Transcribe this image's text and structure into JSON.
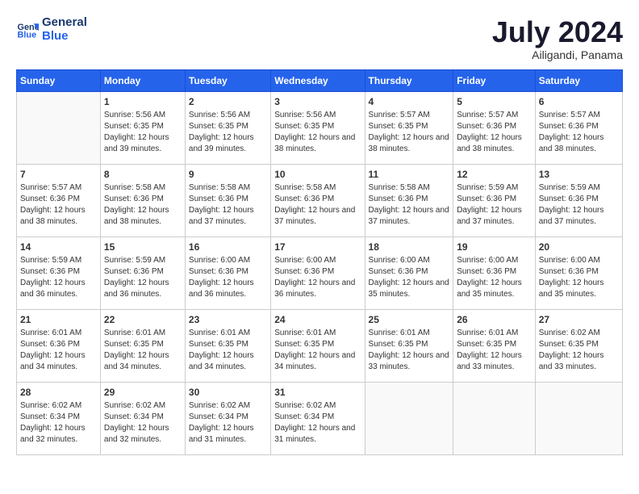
{
  "header": {
    "logo_line1": "General",
    "logo_line2": "Blue",
    "month_title": "July 2024",
    "location": "Ailigandi, Panama"
  },
  "weekdays": [
    "Sunday",
    "Monday",
    "Tuesday",
    "Wednesday",
    "Thursday",
    "Friday",
    "Saturday"
  ],
  "weeks": [
    [
      {
        "day": "",
        "sunrise": "",
        "sunset": "",
        "daylight": ""
      },
      {
        "day": "1",
        "sunrise": "5:56 AM",
        "sunset": "6:35 PM",
        "daylight": "12 hours and 39 minutes."
      },
      {
        "day": "2",
        "sunrise": "5:56 AM",
        "sunset": "6:35 PM",
        "daylight": "12 hours and 39 minutes."
      },
      {
        "day": "3",
        "sunrise": "5:56 AM",
        "sunset": "6:35 PM",
        "daylight": "12 hours and 38 minutes."
      },
      {
        "day": "4",
        "sunrise": "5:57 AM",
        "sunset": "6:35 PM",
        "daylight": "12 hours and 38 minutes."
      },
      {
        "day": "5",
        "sunrise": "5:57 AM",
        "sunset": "6:36 PM",
        "daylight": "12 hours and 38 minutes."
      },
      {
        "day": "6",
        "sunrise": "5:57 AM",
        "sunset": "6:36 PM",
        "daylight": "12 hours and 38 minutes."
      }
    ],
    [
      {
        "day": "7",
        "sunrise": "5:57 AM",
        "sunset": "6:36 PM",
        "daylight": "12 hours and 38 minutes."
      },
      {
        "day": "8",
        "sunrise": "5:58 AM",
        "sunset": "6:36 PM",
        "daylight": "12 hours and 38 minutes."
      },
      {
        "day": "9",
        "sunrise": "5:58 AM",
        "sunset": "6:36 PM",
        "daylight": "12 hours and 37 minutes."
      },
      {
        "day": "10",
        "sunrise": "5:58 AM",
        "sunset": "6:36 PM",
        "daylight": "12 hours and 37 minutes."
      },
      {
        "day": "11",
        "sunrise": "5:58 AM",
        "sunset": "6:36 PM",
        "daylight": "12 hours and 37 minutes."
      },
      {
        "day": "12",
        "sunrise": "5:59 AM",
        "sunset": "6:36 PM",
        "daylight": "12 hours and 37 minutes."
      },
      {
        "day": "13",
        "sunrise": "5:59 AM",
        "sunset": "6:36 PM",
        "daylight": "12 hours and 37 minutes."
      }
    ],
    [
      {
        "day": "14",
        "sunrise": "5:59 AM",
        "sunset": "6:36 PM",
        "daylight": "12 hours and 36 minutes."
      },
      {
        "day": "15",
        "sunrise": "5:59 AM",
        "sunset": "6:36 PM",
        "daylight": "12 hours and 36 minutes."
      },
      {
        "day": "16",
        "sunrise": "6:00 AM",
        "sunset": "6:36 PM",
        "daylight": "12 hours and 36 minutes."
      },
      {
        "day": "17",
        "sunrise": "6:00 AM",
        "sunset": "6:36 PM",
        "daylight": "12 hours and 36 minutes."
      },
      {
        "day": "18",
        "sunrise": "6:00 AM",
        "sunset": "6:36 PM",
        "daylight": "12 hours and 35 minutes."
      },
      {
        "day": "19",
        "sunrise": "6:00 AM",
        "sunset": "6:36 PM",
        "daylight": "12 hours and 35 minutes."
      },
      {
        "day": "20",
        "sunrise": "6:00 AM",
        "sunset": "6:36 PM",
        "daylight": "12 hours and 35 minutes."
      }
    ],
    [
      {
        "day": "21",
        "sunrise": "6:01 AM",
        "sunset": "6:36 PM",
        "daylight": "12 hours and 34 minutes."
      },
      {
        "day": "22",
        "sunrise": "6:01 AM",
        "sunset": "6:35 PM",
        "daylight": "12 hours and 34 minutes."
      },
      {
        "day": "23",
        "sunrise": "6:01 AM",
        "sunset": "6:35 PM",
        "daylight": "12 hours and 34 minutes."
      },
      {
        "day": "24",
        "sunrise": "6:01 AM",
        "sunset": "6:35 PM",
        "daylight": "12 hours and 34 minutes."
      },
      {
        "day": "25",
        "sunrise": "6:01 AM",
        "sunset": "6:35 PM",
        "daylight": "12 hours and 33 minutes."
      },
      {
        "day": "26",
        "sunrise": "6:01 AM",
        "sunset": "6:35 PM",
        "daylight": "12 hours and 33 minutes."
      },
      {
        "day": "27",
        "sunrise": "6:02 AM",
        "sunset": "6:35 PM",
        "daylight": "12 hours and 33 minutes."
      }
    ],
    [
      {
        "day": "28",
        "sunrise": "6:02 AM",
        "sunset": "6:34 PM",
        "daylight": "12 hours and 32 minutes."
      },
      {
        "day": "29",
        "sunrise": "6:02 AM",
        "sunset": "6:34 PM",
        "daylight": "12 hours and 32 minutes."
      },
      {
        "day": "30",
        "sunrise": "6:02 AM",
        "sunset": "6:34 PM",
        "daylight": "12 hours and 31 minutes."
      },
      {
        "day": "31",
        "sunrise": "6:02 AM",
        "sunset": "6:34 PM",
        "daylight": "12 hours and 31 minutes."
      },
      {
        "day": "",
        "sunrise": "",
        "sunset": "",
        "daylight": ""
      },
      {
        "day": "",
        "sunrise": "",
        "sunset": "",
        "daylight": ""
      },
      {
        "day": "",
        "sunrise": "",
        "sunset": "",
        "daylight": ""
      }
    ]
  ]
}
